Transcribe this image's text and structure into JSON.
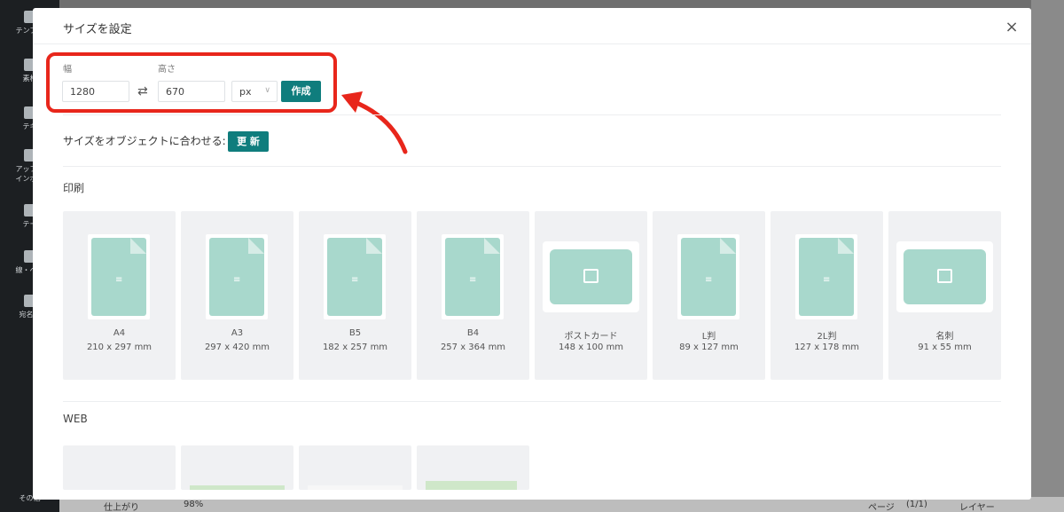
{
  "sidebar": {
    "items": [
      {
        "label": "テンプレ",
        "icon": "template-icon"
      },
      {
        "label": "素材",
        "icon": "gear-icon"
      },
      {
        "label": "テキ",
        "icon": "text-icon"
      },
      {
        "label": "アップロ",
        "icon": "upload-icon"
      },
      {
        "label": "インポー",
        "icon": "import-icon"
      },
      {
        "label": "テー",
        "icon": "palette-icon"
      },
      {
        "label": "線・ペン",
        "icon": "line-icon"
      },
      {
        "label": "宛名印",
        "icon": "print-icon"
      },
      {
        "label": "その他",
        "icon": "more-icon"
      }
    ]
  },
  "modal": {
    "title": "サイズを設定",
    "close_label": "×",
    "width_label": "幅",
    "height_label": "高さ",
    "width_value": "1280",
    "height_value": "670",
    "swap_icon": "⇄",
    "unit_value": "px",
    "create_label": "作成",
    "fit_text": "サイズをオブジェクトに合わせる:",
    "update_label": "更 新",
    "print_title": "印刷",
    "web_title": "WEB"
  },
  "presets": [
    {
      "name": "A4",
      "dim": "210 x 297 mm",
      "shape": "doc"
    },
    {
      "name": "A3",
      "dim": "297 x 420 mm",
      "shape": "doc"
    },
    {
      "name": "B5",
      "dim": "182 x 257 mm",
      "shape": "doc"
    },
    {
      "name": "B4",
      "dim": "257 x 364 mm",
      "shape": "doc"
    },
    {
      "name": "ポストカード",
      "dim": "148 x 100 mm",
      "shape": "landscape"
    },
    {
      "name": "L判",
      "dim": "89 x 127 mm",
      "shape": "doc"
    },
    {
      "name": "2L判",
      "dim": "127 x 178 mm",
      "shape": "doc"
    },
    {
      "name": "名刺",
      "dim": "91 x 55 mm",
      "shape": "landscape"
    }
  ],
  "bottom_bar": {
    "finish": "仕上がり",
    "zoom": "98%",
    "page": "ページ",
    "page_count": "(1/1)",
    "layer": "レイヤー"
  },
  "colors": {
    "accent": "#0f7d7d",
    "highlight": "#e8261b",
    "preset_fill": "#a8d8cc"
  }
}
